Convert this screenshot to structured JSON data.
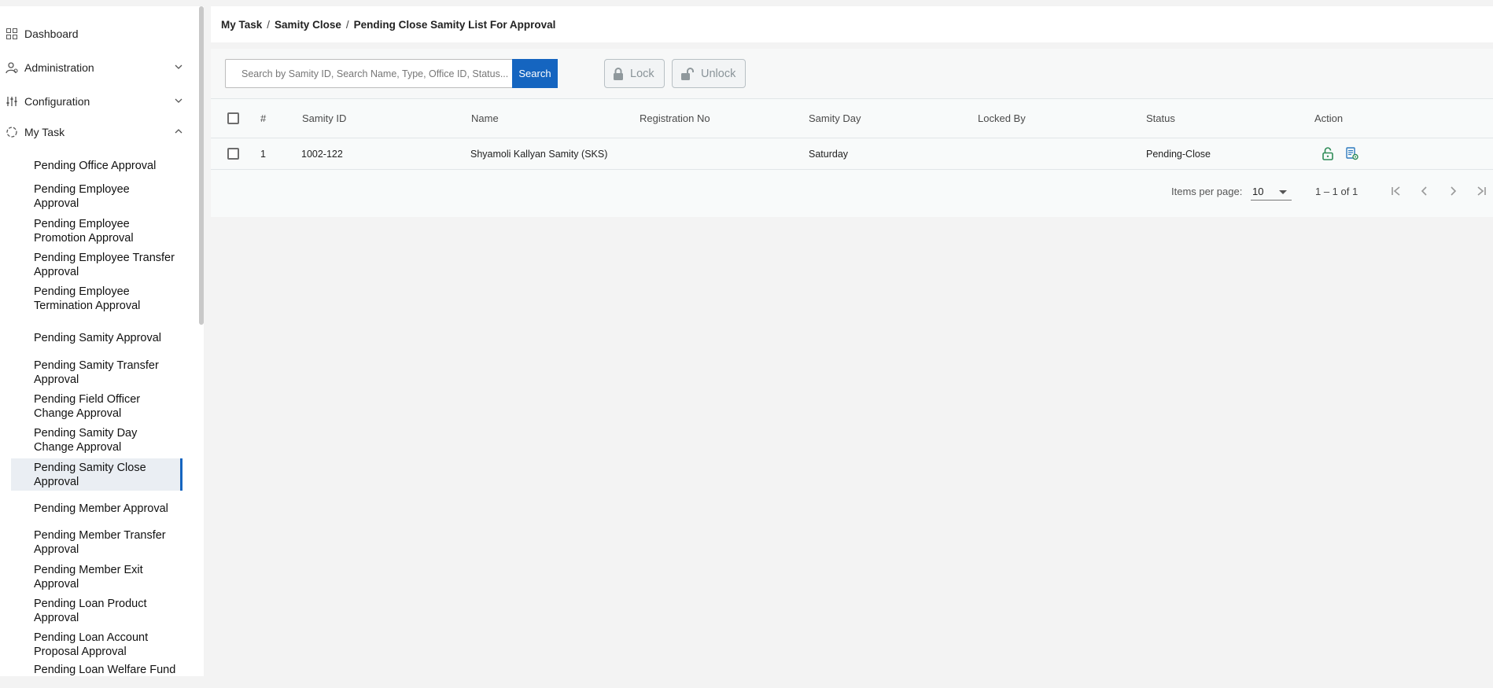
{
  "sidebar": {
    "top_items": [
      {
        "label": "Dashboard",
        "icon": "grid-icon",
        "expandable": false
      },
      {
        "label": "Administration",
        "icon": "users-cog-icon",
        "expandable": true,
        "expanded": false
      },
      {
        "label": "Configuration",
        "icon": "sliders-icon",
        "expandable": true,
        "expanded": false
      },
      {
        "label": "My Task",
        "icon": "task-circle-icon",
        "expandable": true,
        "expanded": true
      }
    ],
    "sub_items": [
      "Pending Office Approval",
      "Pending Employee Approval",
      "Pending Employee Promotion Approval",
      "Pending Employee Transfer Approval",
      "Pending Employee Termination Approval",
      "Pending Samity Approval",
      "Pending Samity Transfer Approval",
      "Pending Field Officer Change Approval",
      "Pending Samity Day Change Approval",
      "Pending Samity Close Approval",
      "Pending Member Approval",
      "Pending Member Transfer Approval",
      "Pending Member Exit Approval",
      "Pending Loan Product Approval",
      "Pending Loan Account Proposal Approval",
      "Pending Loan Welfare Fund Approval"
    ],
    "active_item": "Pending Samity Close Approval"
  },
  "breadcrumb": [
    "My Task",
    "Samity Close",
    "Pending Close Samity List For Approval"
  ],
  "toolbar": {
    "search_placeholder": "Search by Samity ID, Search Name, Type, Office ID, Status...",
    "search_value": "",
    "search_label": "Search",
    "lock_label": "Lock",
    "unlock_label": "Unlock"
  },
  "table": {
    "columns": [
      "#",
      "Samity ID",
      "Name",
      "Registration No",
      "Samity Day",
      "Locked By",
      "Status",
      "Action"
    ],
    "rows": [
      {
        "num": "1",
        "samity_id": "1002-122",
        "name": "Shyamoli Kallyan Samity (SKS)",
        "registration_no": "",
        "samity_day": "Saturday",
        "locked_by": "",
        "status": "Pending-Close",
        "actions": [
          "unlock-icon",
          "document-view-icon"
        ]
      }
    ]
  },
  "pagination": {
    "items_per_page_label": "Items per page:",
    "items_per_page": "10",
    "range": "1 – 1 of 1"
  },
  "colors": {
    "primary": "#1565c0",
    "action_green": "#2e8b57",
    "active_indicator": "#1565c0"
  }
}
